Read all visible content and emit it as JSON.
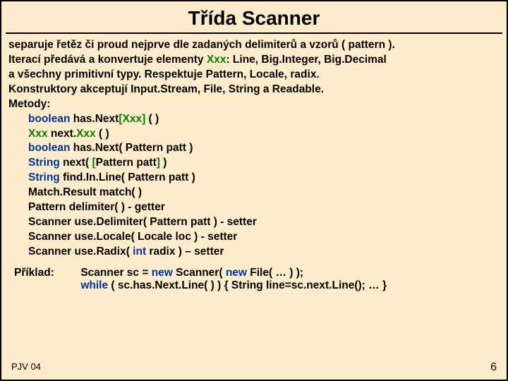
{
  "title": "Třída   Scanner",
  "intro": {
    "l1a": "separuje řetěz či proud nejprve dle zadaných delimiterů a vzorů ( pattern ).",
    "l2a": "Iterací předává a konvertuje elementy ",
    "l2b": "Xxx",
    "l2c": ": Line, Big.Integer, Big.Decimal",
    "l3": "a všechny primitivní typy.   Respektuje Pattern, Locale, radix.",
    "l4": "Konstruktory akceptují Input.Stream, File, String a Readable.",
    "l5": "Metody:"
  },
  "methods": {
    "m1a": "boolean",
    "m1b": "  has.Next",
    "m1c": "[Xxx]",
    "m1d": " ( )",
    "m2a": "Xxx",
    "m2b": "         next.",
    "m2c": "Xxx",
    "m2d": " ( )",
    "m3a": "boolean",
    "m3b": "  has.Next( Pattern patt )",
    "m4a": "String",
    "m4b": "     next( ",
    "m4c": "[",
    "m4d": "Pattern patt",
    "m4e": "]",
    "m4f": " )",
    "m5a": "String",
    "m5b": "     find.In.Line( Pattern patt )",
    "m6": "Match.Result  match( )",
    "m7": "Pattern   delimiter( ) - getter",
    "m8": "Scanner  use.Delimiter( Pattern patt ) - setter",
    "m9": "Scanner  use.Locale( Locale loc ) - setter",
    "m10a": "Scanner  use.Radix( ",
    "m10b": "int",
    "m10c": " radix ) – setter"
  },
  "example": {
    "label": "Příklad:",
    "l1a": "Scanner  sc = ",
    "l1b": "new",
    "l1c": " Scanner( ",
    "l1d": "new",
    "l1e": " File( ",
    "l1f": "…",
    "l1g": " ) );",
    "l2a": "  ",
    "l2b": "while",
    "l2c": " ( sc.has.Next.Line( ) )  { String line=sc.next.Line();  ",
    "l2d": "…",
    "l2e": " }"
  },
  "footer": {
    "left": "PJV 04",
    "right": "6"
  }
}
